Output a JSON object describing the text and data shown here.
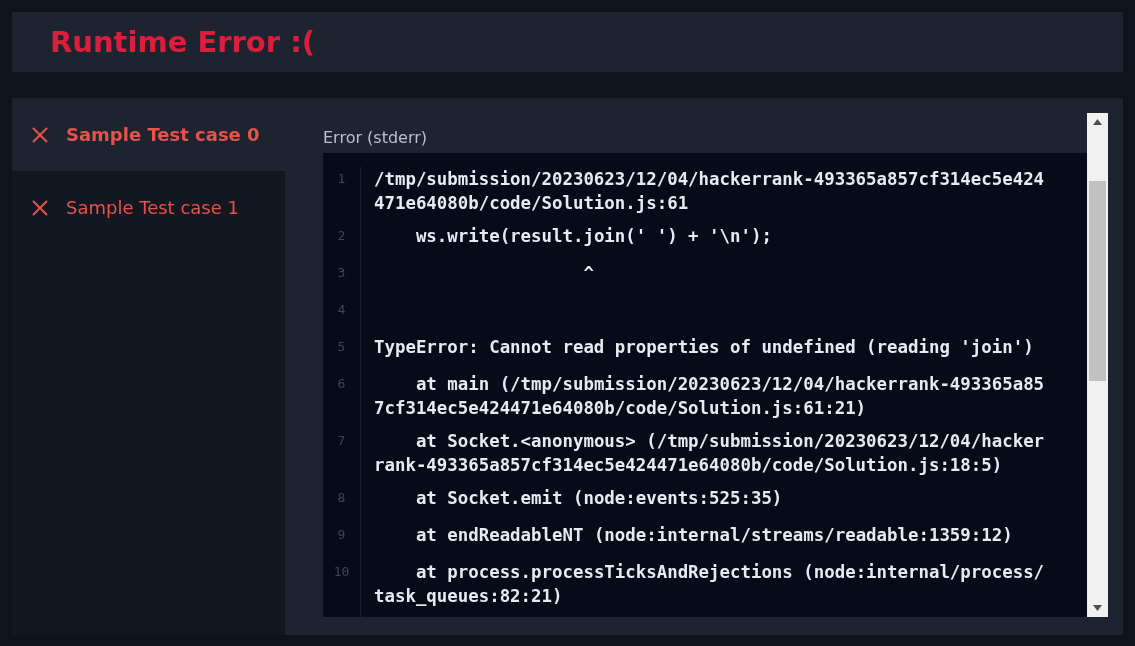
{
  "title": "Runtime Error :(",
  "test_cases": [
    {
      "label": "Sample Test case 0",
      "selected": true
    },
    {
      "label": "Sample Test case 1",
      "selected": false
    }
  ],
  "output": {
    "label": "Error (stderr)",
    "lines": [
      {
        "number": "1",
        "text": "/tmp/submission/20230623/12/04/hackerrank-493365a857cf314ec5e424471e64080b/code/Solution.js:61"
      },
      {
        "number": "2",
        "text": "    ws.write(result.join(' ') + '\\n');"
      },
      {
        "number": "3",
        "text": "                    ^"
      },
      {
        "number": "4"
      },
      {
        "number": "5",
        "text": "TypeError: Cannot read properties of undefined (reading 'join')"
      },
      {
        "number": "6",
        "text": "    at main (/tmp/submission/20230623/12/04/hackerrank-493365a857cf314ec5e424471e64080b/code/Solution.js:61:21)"
      },
      {
        "number": "7",
        "text": "    at Socket.<anonymous> (/tmp/submission/20230623/12/04/hackerrank-493365a857cf314ec5e424471e64080b/code/Solution.js:18:5)"
      },
      {
        "number": "8",
        "text": "    at Socket.emit (node:events:525:35)"
      },
      {
        "number": "9",
        "text": "    at endReadableNT (node:internal/streams/readable:1359:12)"
      },
      {
        "number": "10",
        "text": "    at process.processTicksAndRejections (node:internal/process/task_queues:82:21)"
      }
    ]
  }
}
